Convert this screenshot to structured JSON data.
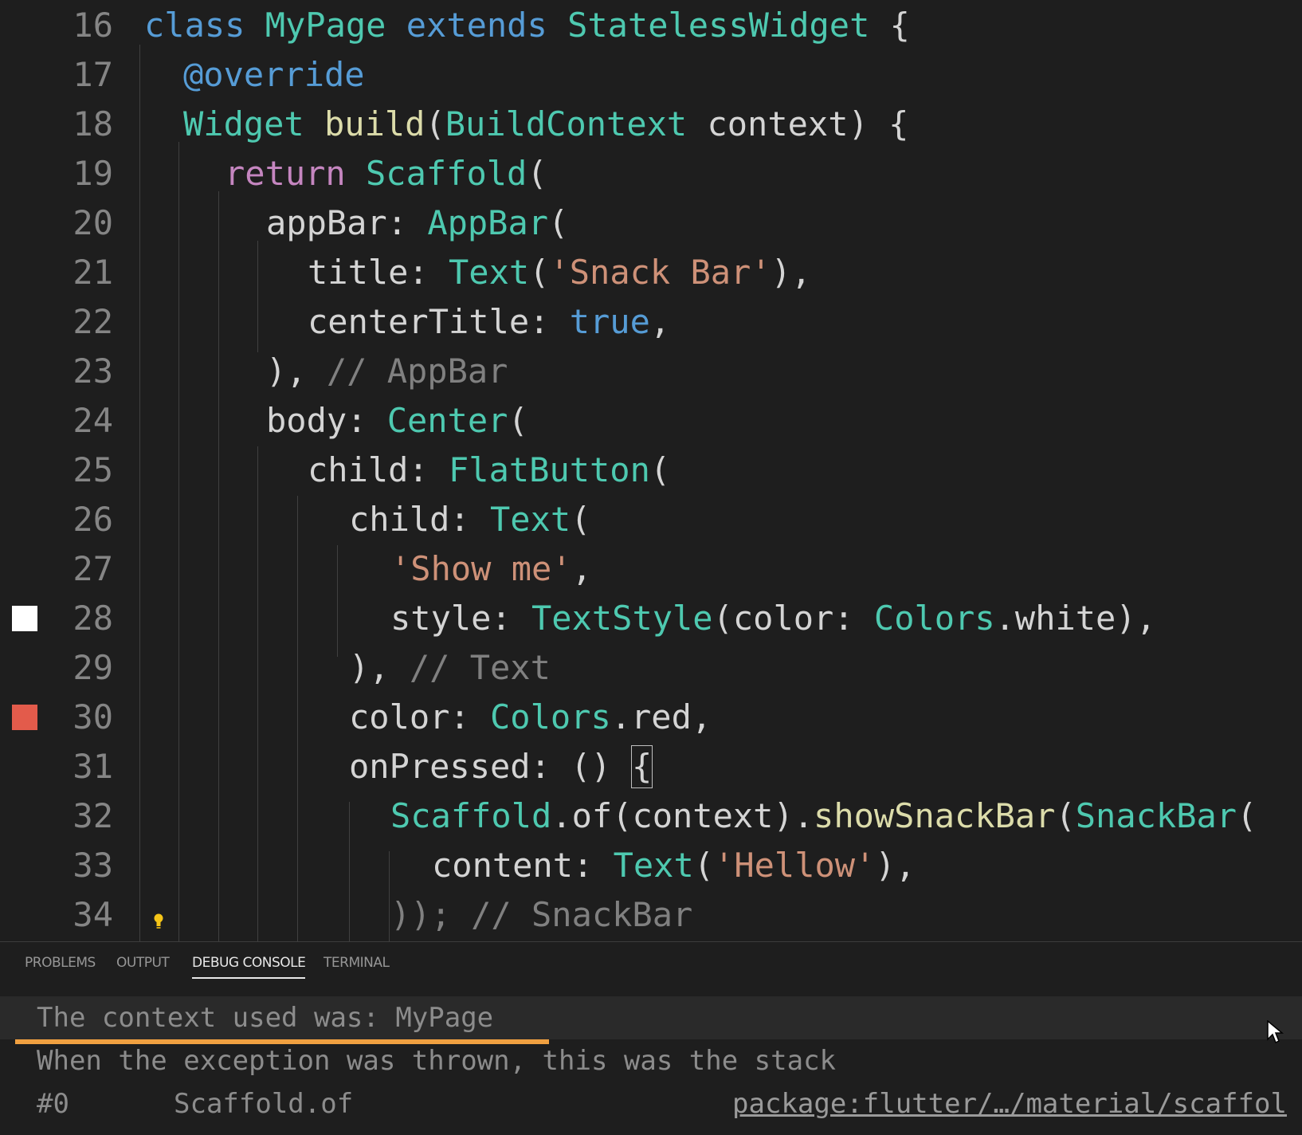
{
  "editor": {
    "lines": [
      {
        "n": "16"
      },
      {
        "n": "17"
      },
      {
        "n": "18"
      },
      {
        "n": "19"
      },
      {
        "n": "20"
      },
      {
        "n": "21"
      },
      {
        "n": "22"
      },
      {
        "n": "23"
      },
      {
        "n": "24"
      },
      {
        "n": "25"
      },
      {
        "n": "26"
      },
      {
        "n": "27"
      },
      {
        "n": "28"
      },
      {
        "n": "29"
      },
      {
        "n": "30"
      },
      {
        "n": "31"
      },
      {
        "n": "32"
      },
      {
        "n": "33"
      },
      {
        "n": "34"
      }
    ],
    "tokens": {
      "l16": [
        "class",
        "MyPage",
        "extends",
        "StatelessWidget",
        "{"
      ],
      "l17": [
        "@override"
      ],
      "l18": [
        "Widget",
        "build",
        "(",
        "BuildContext",
        "context",
        ") {"
      ],
      "l19": [
        "return",
        "Scaffold",
        "("
      ],
      "l20": [
        "appBar:",
        "AppBar",
        "("
      ],
      "l21": [
        "title:",
        "Text",
        "(",
        "'Snack Bar'",
        "),"
      ],
      "l22": [
        "centerTitle:",
        "true",
        ","
      ],
      "l23": [
        "),",
        "// AppBar"
      ],
      "l24": [
        "body:",
        "Center",
        "("
      ],
      "l25": [
        "child:",
        "FlatButton",
        "("
      ],
      "l26": [
        "child:",
        "Text",
        "("
      ],
      "l27": [
        "'Show me'",
        ","
      ],
      "l28": [
        "style:",
        "TextStyle",
        "(color:",
        "Colors",
        ".white),"
      ],
      "l29": [
        "),",
        "// Text"
      ],
      "l30": [
        "color:",
        "Colors",
        ".red,"
      ],
      "l31": [
        "onPressed:",
        "()",
        "{"
      ],
      "l32": [
        "Scaffold",
        ".of(context).",
        "showSnackBar",
        "(",
        "SnackBar",
        "("
      ],
      "l33": [
        "content:",
        "Text",
        "(",
        "'Hellow'",
        "),"
      ],
      "l34": [
        ")); // SnackBar"
      ]
    },
    "color_swatches": {
      "l28": "#ffffff",
      "l30": "#e35b4b"
    }
  },
  "panel": {
    "tabs": [
      "PROBLEMS",
      "OUTPUT",
      "DEBUG CONSOLE",
      "TERMINAL"
    ],
    "active_tab": "DEBUG CONSOLE",
    "console": {
      "line1": "The context used was: MyPage",
      "line2": "When the exception was thrown, this was the stack",
      "line3_frame": "#0",
      "line3_fn": "Scaffold.of",
      "line3_link": "package:flutter/…/material/scaffol"
    }
  }
}
